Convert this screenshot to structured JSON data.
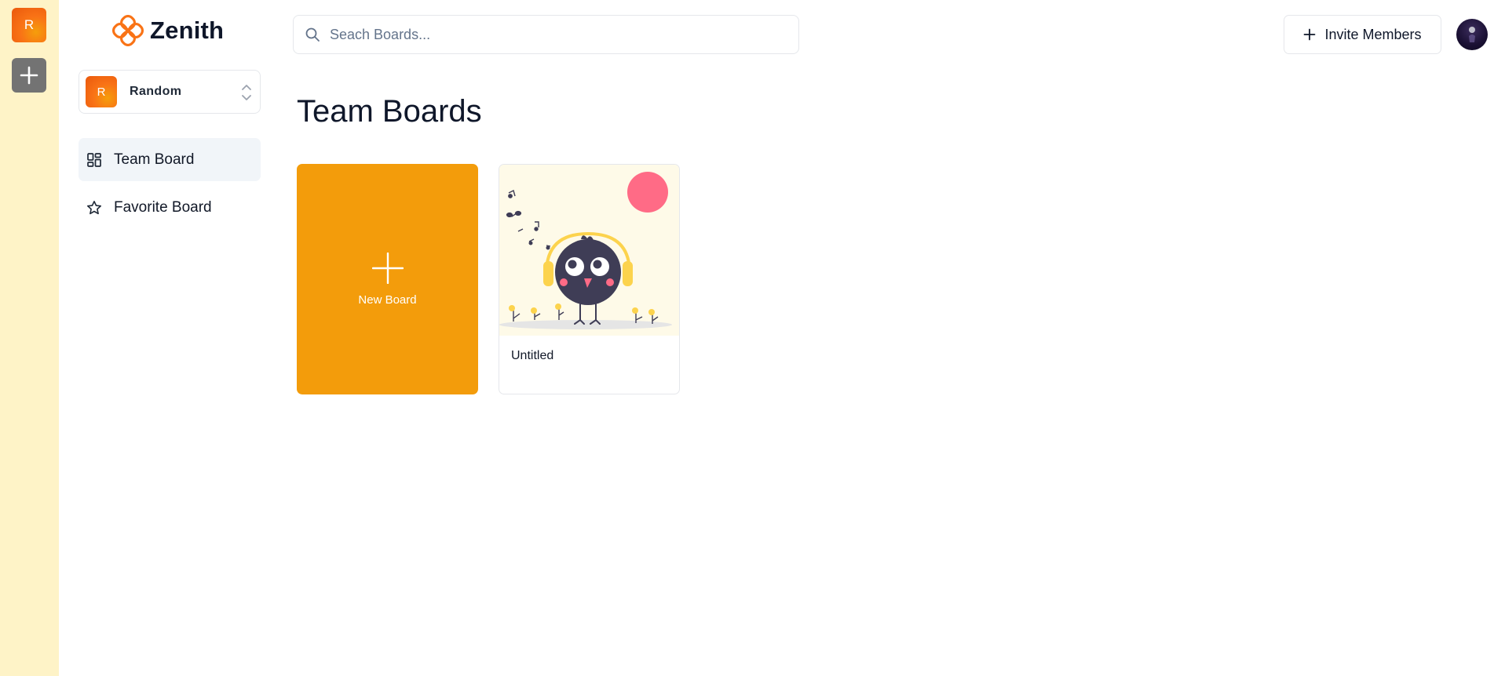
{
  "rail": {
    "org_initial": "R",
    "add_icon": "plus-icon"
  },
  "sidebar": {
    "brand": {
      "name": "Zenith",
      "icon": "zenith-logo-icon",
      "color": "#f97316"
    },
    "workspace": {
      "initial": "R",
      "name": "Random",
      "switch_icon": "chevron-up-down-icon"
    },
    "nav": [
      {
        "label": "Team Board",
        "icon": "dashboard-grid-icon",
        "active": true
      },
      {
        "label": "Favorite Board",
        "icon": "star-icon",
        "active": false
      }
    ]
  },
  "header": {
    "search": {
      "placeholder": "Seach Boards...",
      "value": "",
      "icon": "search-icon"
    },
    "invite": {
      "label": "Invite Members",
      "icon": "plus-icon"
    },
    "avatar_icon": "user-avatar"
  },
  "main": {
    "title": "Team Boards",
    "new_board": {
      "label": "New Board",
      "icon": "plus-icon",
      "color": "#f39c0b"
    },
    "boards": [
      {
        "title": "Untitled",
        "thumbnail": "bird-with-headphones-illustration"
      }
    ]
  }
}
